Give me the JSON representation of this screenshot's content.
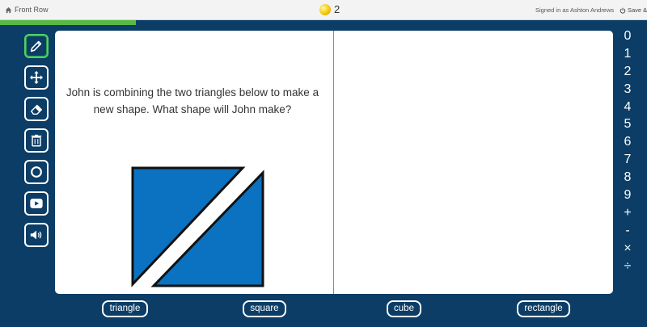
{
  "topbar": {
    "home_label": "Front Row",
    "coin_count": "2",
    "signed_in": "Signed in as Ashton Andrews",
    "save_label": "Save &"
  },
  "progress": {
    "fraction": 0.21,
    "color": "#58b947"
  },
  "toolbar": {
    "tools": [
      "pencil-icon",
      "move-icon",
      "eraser-icon",
      "trash-icon",
      "circle-icon",
      "video-icon",
      "audio-icon"
    ],
    "active_tool": "pencil-icon"
  },
  "question": {
    "text": "John is combining the two triangles below to make a new shape. What shape will John make?"
  },
  "figure": {
    "fill": "#0a72c0",
    "stroke": "#111111",
    "shape": "two-right-triangles"
  },
  "numpad": [
    "0",
    "1",
    "2",
    "3",
    "4",
    "5",
    "6",
    "7",
    "8",
    "9",
    "+",
    "-",
    "×",
    "÷"
  ],
  "answers": [
    "triangle",
    "square",
    "cube",
    "rectangle"
  ],
  "colors": {
    "background": "#0b3d66",
    "canvas": "#ffffff",
    "accent": "#4ecf6a"
  }
}
